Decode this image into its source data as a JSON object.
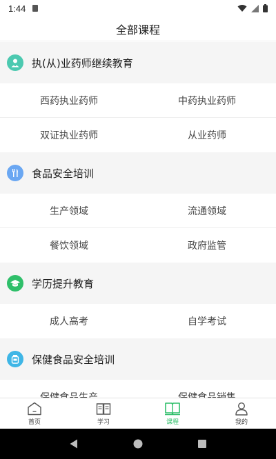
{
  "status": {
    "time": "1:44"
  },
  "header": {
    "title": "全部课程"
  },
  "sections": [
    {
      "title": "执(从)业药师继续教育",
      "icon": "pharmacist-icon",
      "color": "#4cc9b0",
      "items": [
        "西药执业药师",
        "中药执业药师",
        "双证执业药师",
        "从业药师"
      ]
    },
    {
      "title": "食品安全培训",
      "icon": "fork-knife-icon",
      "color": "#6aa7f2",
      "items": [
        "生产领域",
        "流通领域",
        "餐饮领域",
        "政府监管"
      ]
    },
    {
      "title": "学历提升教育",
      "icon": "graduation-cap-icon",
      "color": "#2fbf6a",
      "items": [
        "成人高考",
        "自学考试"
      ]
    },
    {
      "title": "保健食品安全培训",
      "icon": "jar-icon",
      "color": "#3fb6e6",
      "items": [
        "保健食品生产",
        "保健食品销售"
      ]
    }
  ],
  "nav": [
    {
      "label": "首页",
      "icon": "home-icon"
    },
    {
      "label": "学习",
      "icon": "book-icon"
    },
    {
      "label": "课程",
      "icon": "course-icon",
      "active": true
    },
    {
      "label": "我的",
      "icon": "profile-icon"
    }
  ],
  "colors": {
    "accent": "#2fbf6a"
  }
}
